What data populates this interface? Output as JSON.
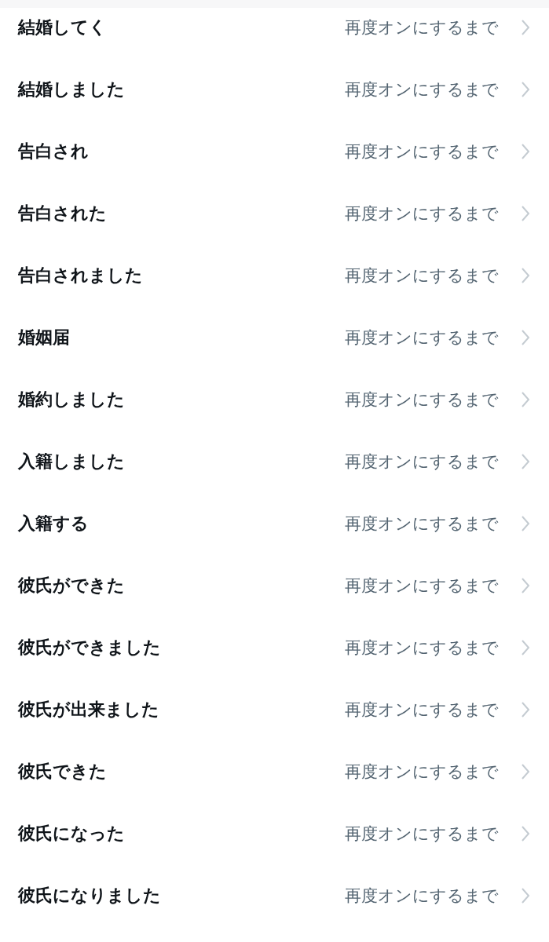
{
  "rows": [
    {
      "label": "結婚してく",
      "value": "再度オンにするまで"
    },
    {
      "label": "結婚しました",
      "value": "再度オンにするまで"
    },
    {
      "label": "告白され",
      "value": "再度オンにするまで"
    },
    {
      "label": "告白された",
      "value": "再度オンにするまで"
    },
    {
      "label": "告白されました",
      "value": "再度オンにするまで"
    },
    {
      "label": "婚姻届",
      "value": "再度オンにするまで"
    },
    {
      "label": "婚約しました",
      "value": "再度オンにするまで"
    },
    {
      "label": "入籍しました",
      "value": "再度オンにするまで"
    },
    {
      "label": "入籍する",
      "value": "再度オンにするまで"
    },
    {
      "label": "彼氏ができた",
      "value": "再度オンにするまで"
    },
    {
      "label": "彼氏ができました",
      "value": "再度オンにするまで"
    },
    {
      "label": "彼氏が出来ました",
      "value": "再度オンにするまで"
    },
    {
      "label": "彼氏できた",
      "value": "再度オンにするまで"
    },
    {
      "label": "彼氏になった",
      "value": "再度オンにするまで"
    },
    {
      "label": "彼氏になりました",
      "value": "再度オンにするまで"
    }
  ]
}
